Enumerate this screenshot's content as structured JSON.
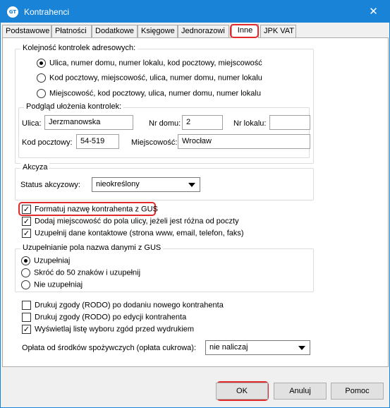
{
  "window": {
    "title": "Kontrahenci",
    "icon_text": "GT",
    "close_glyph": "✕",
    "accent_color": "#1883d7",
    "highlight_color": "#e32a2a"
  },
  "tabs": [
    {
      "label": "Podstawowe",
      "active": false
    },
    {
      "label": "Płatności",
      "active": false
    },
    {
      "label": "Dodatkowe",
      "active": false
    },
    {
      "label": "Księgowe",
      "active": false
    },
    {
      "label": "Jednorazowi",
      "active": false
    },
    {
      "label": "Inne",
      "active": true
    },
    {
      "label": "JPK VAT",
      "active": false
    }
  ],
  "address_order": {
    "legend": "Kolejność kontrolek adresowych:",
    "options": [
      {
        "label": "Ulica, numer domu, numer lokalu, kod pocztowy, miejscowość",
        "selected": true
      },
      {
        "label": "Kod pocztowy, miejscowość, ulica, numer domu, numer lokalu",
        "selected": false
      },
      {
        "label": "Miejscowość, kod pocztowy, ulica, numer domu, numer lokalu",
        "selected": false
      }
    ],
    "preview": {
      "legend": "Podgląd ułożenia kontrolek:",
      "street_label": "Ulica:",
      "street_value": "Jerzmanowska",
      "house_label": "Nr domu:",
      "house_value": "2",
      "apt_label": "Nr lokalu:",
      "apt_value": "",
      "postal_label": "Kod pocztowy:",
      "postal_value": "54-519",
      "city_label": "Miejscowość:",
      "city_value": "Wrocław"
    }
  },
  "excise": {
    "legend": "Akcyza",
    "status_label": "Status akcyzowy:",
    "status_value": "nieokreślony"
  },
  "options": {
    "format_name": {
      "label": "Formatuj nazwę kontrahenta z GUS",
      "checked": true
    },
    "add_city": {
      "label": "Dodaj miejscowość do pola ulicy, jeżeli jest różna od poczty",
      "checked": true
    },
    "fill_contacts": {
      "label": "Uzupełnij dane kontaktowe (strona www, email, telefon, faks)",
      "checked": true
    }
  },
  "gus_fill": {
    "legend": "Uzupełnianie pola nazwa danymi z GUS",
    "options": [
      {
        "label": "Uzupełniaj",
        "selected": true
      },
      {
        "label": "Skróć do 50 znaków i uzupełnij",
        "selected": false
      },
      {
        "label": "Nie uzupełniaj",
        "selected": false
      }
    ]
  },
  "rodo": {
    "print_new": {
      "label": "Drukuj zgody (RODO) po dodaniu nowego kontrahenta",
      "checked": false
    },
    "print_edit": {
      "label": "Drukuj zgody (RODO) po edycji kontrahenta",
      "checked": false
    },
    "show_list": {
      "label": "Wyświetlaj listę wyboru zgód przed wydrukiem",
      "checked": true
    }
  },
  "sugar_fee": {
    "label": "Opłata od środków spożywczych (opłata cukrowa):",
    "value": "nie naliczaj"
  },
  "buttons": {
    "ok": "OK",
    "cancel": "Anuluj",
    "help": "Pomoc"
  }
}
